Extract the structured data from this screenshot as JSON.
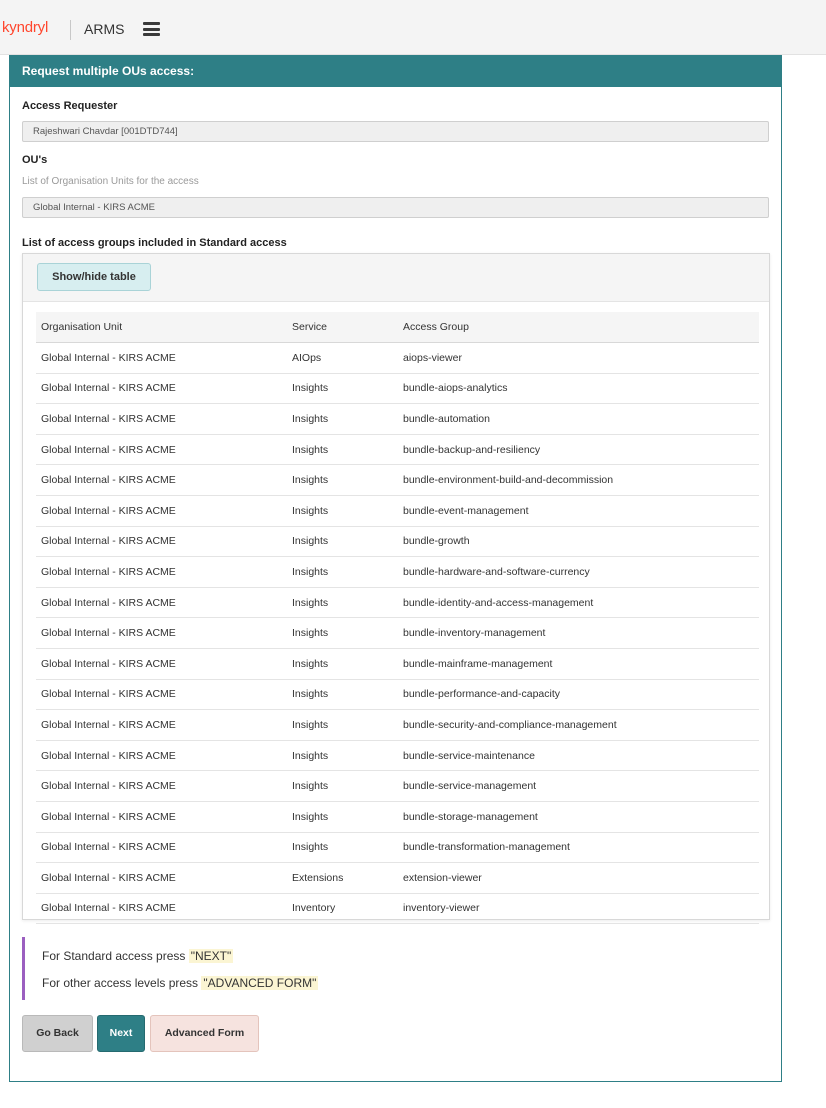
{
  "header": {
    "brand": "kyndryl",
    "app_name": "ARMS"
  },
  "panel": {
    "title": "Request multiple OUs access:"
  },
  "form": {
    "requester_label": "Access Requester",
    "requester_value": "Rajeshwari Chavdar [001DTD744]",
    "ous_label": "OU's",
    "ous_hint": "List of Organisation Units for the access",
    "ous_value": "Global Internal - KIRS ACME",
    "groups_label": "List of access groups included in Standard access"
  },
  "table": {
    "toggle_label": "Show/hide table",
    "columns": [
      "Organisation Unit",
      "Service",
      "Access Group"
    ],
    "rows": [
      [
        "Global Internal - KIRS ACME",
        "AIOps",
        "aiops-viewer"
      ],
      [
        "Global Internal - KIRS ACME",
        "Insights",
        "bundle-aiops-analytics"
      ],
      [
        "Global Internal - KIRS ACME",
        "Insights",
        "bundle-automation"
      ],
      [
        "Global Internal - KIRS ACME",
        "Insights",
        "bundle-backup-and-resiliency"
      ],
      [
        "Global Internal - KIRS ACME",
        "Insights",
        "bundle-environment-build-and-decommission"
      ],
      [
        "Global Internal - KIRS ACME",
        "Insights",
        "bundle-event-management"
      ],
      [
        "Global Internal - KIRS ACME",
        "Insights",
        "bundle-growth"
      ],
      [
        "Global Internal - KIRS ACME",
        "Insights",
        "bundle-hardware-and-software-currency"
      ],
      [
        "Global Internal - KIRS ACME",
        "Insights",
        "bundle-identity-and-access-management"
      ],
      [
        "Global Internal - KIRS ACME",
        "Insights",
        "bundle-inventory-management"
      ],
      [
        "Global Internal - KIRS ACME",
        "Insights",
        "bundle-mainframe-management"
      ],
      [
        "Global Internal - KIRS ACME",
        "Insights",
        "bundle-performance-and-capacity"
      ],
      [
        "Global Internal - KIRS ACME",
        "Insights",
        "bundle-security-and-compliance-management"
      ],
      [
        "Global Internal - KIRS ACME",
        "Insights",
        "bundle-service-maintenance"
      ],
      [
        "Global Internal - KIRS ACME",
        "Insights",
        "bundle-service-management"
      ],
      [
        "Global Internal - KIRS ACME",
        "Insights",
        "bundle-storage-management"
      ],
      [
        "Global Internal - KIRS ACME",
        "Insights",
        "bundle-transformation-management"
      ],
      [
        "Global Internal - KIRS ACME",
        "Extensions",
        "extension-viewer"
      ],
      [
        "Global Internal - KIRS ACME",
        "Inventory",
        "inventory-viewer"
      ]
    ]
  },
  "note": {
    "line1_prefix": "For Standard access press",
    "line1_highlight": "\"NEXT\"",
    "line2_prefix": "For other access levels press",
    "line2_highlight": "\"ADVANCED FORM\""
  },
  "buttons": {
    "back": "Go Back",
    "next": "Next",
    "advanced": "Advanced Form"
  },
  "colors": {
    "brand": "#ff462d",
    "accent": "#2e7f86",
    "note_border": "#9b5fc0"
  }
}
